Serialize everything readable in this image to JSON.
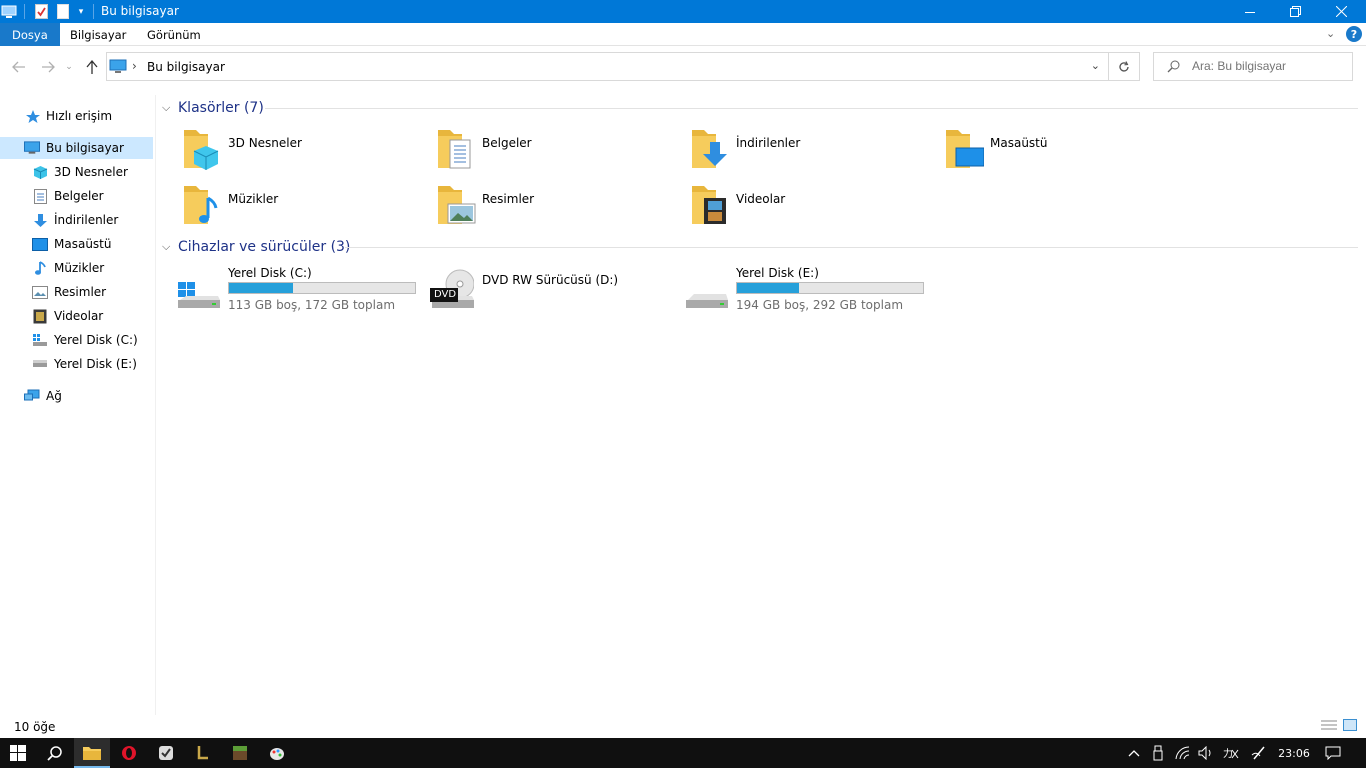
{
  "window": {
    "title": "Bu bilgisayar"
  },
  "ribbon": {
    "tabs": [
      "Dosya",
      "Bilgisayar",
      "Görünüm"
    ],
    "help": "?"
  },
  "address": {
    "path": "Bu bilgisayar",
    "separator": "›"
  },
  "search": {
    "placeholder": "Ara: Bu bilgisayar"
  },
  "sidebar": {
    "quick_access": "Hızlı erişim",
    "this_pc": "Bu bilgisayar",
    "items": [
      "3D Nesneler",
      "Belgeler",
      "İndirilenler",
      "Masaüstü",
      "Müzikler",
      "Resimler",
      "Videolar",
      "Yerel Disk (C:)",
      "Yerel Disk (E:)"
    ],
    "network": "Ağ"
  },
  "folders_group": {
    "title": "Klasörler (7)"
  },
  "folders": [
    "3D Nesneler",
    "Belgeler",
    "İndirilenler",
    "Masaüstü",
    "Müzikler",
    "Resimler",
    "Videolar"
  ],
  "drives_group": {
    "title": "Cihazlar ve sürücüler (3)"
  },
  "drives": [
    {
      "name": "Yerel Disk (C:)",
      "info": "113 GB boş, 172 GB toplam",
      "used_fraction": 0.343
    },
    {
      "name": "DVD RW Sürücüsü (D:)",
      "badge": "DVD"
    },
    {
      "name": "Yerel Disk (E:)",
      "info": "194 GB boş, 292 GB toplam",
      "used_fraction": 0.336
    }
  ],
  "status": {
    "count": "10 öğe"
  },
  "taskbar": {
    "time": "23:06"
  },
  "colors": {
    "accent": "#0078d7",
    "folder": "#f6cc5c",
    "bar_fill": "#26a0da",
    "group_title": "#1e3287"
  }
}
